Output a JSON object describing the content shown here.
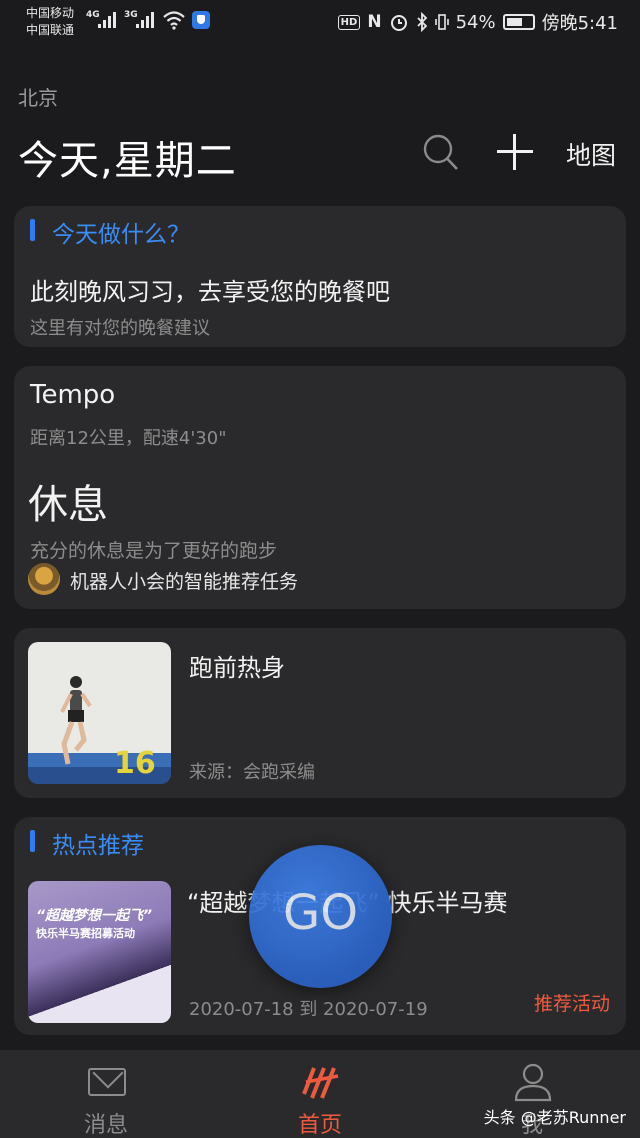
{
  "status_bar": {
    "carrier1": "中国移动",
    "carrier2": "中国联通",
    "net1": "4G",
    "net2": "3G",
    "hd": "HD",
    "nfc": "N",
    "battery": "54%",
    "time": "傍晚5:41"
  },
  "header": {
    "city": "北京",
    "title": "今天,星期二",
    "map_label": "地图"
  },
  "card_today": {
    "section_title": "今天做什么？",
    "headline": "此刻晚风习习，去享受您的晚餐吧",
    "subtitle": "这里有对您的晚餐建议"
  },
  "card_plan": {
    "plan_name": "Tempo",
    "plan_meta": "距离12公里，配速4'30\"",
    "status": "休息",
    "description": "充分的休息是为了更好的跑步",
    "robot_text": "机器人小会的智能推荐任务"
  },
  "card_warmup": {
    "title": "跑前热身",
    "thumb_number": "16",
    "source": "来源：会跑采编"
  },
  "card_hot": {
    "section_title": "热点推荐",
    "poster_line1": "“超越梦想一起飞”",
    "poster_line2": "快乐半马赛招募活动",
    "title": "“超越梦想一起飞” 快乐半马赛",
    "date": "2020-07-18 到 2020-07-19",
    "tag": "推荐活动"
  },
  "go_button": {
    "label": "GO"
  },
  "tabbar": {
    "tabs": [
      {
        "label": "消息",
        "color": "#8c8c8c"
      },
      {
        "label": "首页",
        "color": "#ee5a3e"
      },
      {
        "label": "我",
        "color": "#8c8c8c"
      }
    ]
  },
  "watermark": "头条 @老苏Runner",
  "colors": {
    "accent_blue": "#3a8cf5",
    "accent_orange": "#ee5a3e",
    "background": "#1b1b1d",
    "card": "#2a2a2c"
  }
}
